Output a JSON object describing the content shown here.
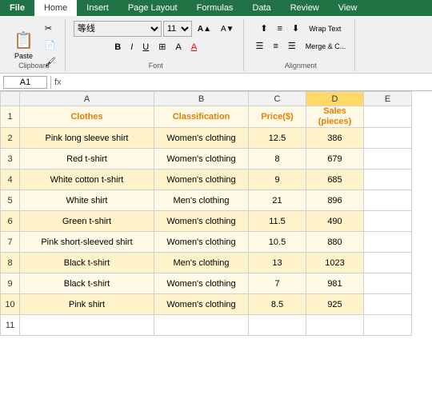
{
  "tabs": [
    {
      "label": "File",
      "active": false
    },
    {
      "label": "Home",
      "active": true
    },
    {
      "label": "Insert",
      "active": false
    },
    {
      "label": "Page Layout",
      "active": false
    },
    {
      "label": "Formulas",
      "active": false
    },
    {
      "label": "Data",
      "active": false
    },
    {
      "label": "Review",
      "active": false
    },
    {
      "label": "View",
      "active": false
    }
  ],
  "ribbon": {
    "clipboard_label": "Clipboard",
    "font_label": "Font",
    "alignment_label": "Alignment",
    "font_name": "等线",
    "font_size": "11",
    "wrap_text": "Wrap Text",
    "merge_cells": "Merge & C..."
  },
  "formula_bar": {
    "name_box": "A1",
    "formula": ""
  },
  "col_headers": [
    "",
    "A",
    "B",
    "C",
    "D",
    "E"
  ],
  "row_headers": [
    "1",
    "2",
    "3",
    "4",
    "5",
    "6",
    "7",
    "8",
    "9",
    "10",
    "11"
  ],
  "spreadsheet": {
    "header": {
      "a": "Clothes",
      "b": "Classification",
      "c": "Price($)",
      "d": "Sales\n(pieces)"
    },
    "rows": [
      {
        "a": "Pink long sleeve shirt",
        "b": "Women's clothing",
        "c": "12.5",
        "d": "386"
      },
      {
        "a": "Red t-shirt",
        "b": "Women's clothing",
        "c": "8",
        "d": "679"
      },
      {
        "a": "White cotton t-shirt",
        "b": "Women's clothing",
        "c": "9",
        "d": "685"
      },
      {
        "a": "White shirt",
        "b": "Men's clothing",
        "c": "21",
        "d": "896"
      },
      {
        "a": "Green t-shirt",
        "b": "Women's clothing",
        "c": "11.5",
        "d": "490"
      },
      {
        "a": "Pink short-sleeved shirt",
        "b": "Women's clothing",
        "c": "10.5",
        "d": "880"
      },
      {
        "a": "Black t-shirt",
        "b": "Men's clothing",
        "c": "13",
        "d": "1023"
      },
      {
        "a": "Black t-shirt",
        "b": "Women's clothing",
        "c": "7",
        "d": "981"
      },
      {
        "a": "Pink shirt",
        "b": "Women's clothing",
        "c": "8.5",
        "d": "925"
      }
    ]
  }
}
